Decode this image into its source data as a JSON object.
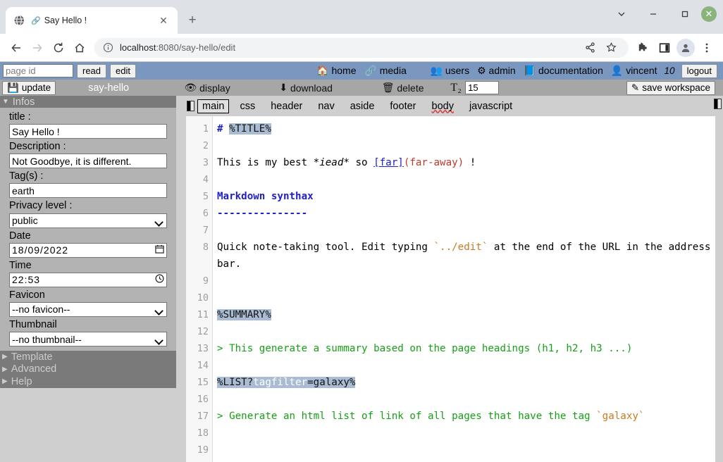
{
  "browser": {
    "tab": {
      "title": "Say Hello !",
      "favicon_icon": "globe-icon",
      "close_icon": "close-icon"
    },
    "newtab_icon": "plus-icon",
    "window": {
      "chevron_icon": "chevron-down-icon",
      "minimize_icon": "minimize-icon",
      "maximize_icon": "maximize-icon",
      "close_icon": "window-close-icon"
    },
    "nav": {
      "back_icon": "back-arrow-icon",
      "forward_icon": "forward-arrow-icon",
      "reload_icon": "reload-icon",
      "home_icon": "home-icon",
      "info_icon": "info-circle-icon",
      "url_host": "localhost",
      "url_path": ":8080/say-hello/edit",
      "share_icon": "share-icon",
      "bookmark_icon": "star-icon",
      "extensions_icon": "puzzle-icon",
      "sidepanel_icon": "side-panel-icon",
      "profile_icon": "profile-avatar-icon",
      "menu_icon": "three-dot-menu-icon"
    }
  },
  "app": {
    "topbar": {
      "page_id_placeholder": "page id",
      "page_id_value": "",
      "read_label": "read",
      "edit_label": "edit",
      "center_links": [
        {
          "icon": "home-icon",
          "label": "home"
        },
        {
          "icon": "link-icon",
          "label": "media"
        }
      ],
      "right_links": [
        {
          "icon": "users-icon",
          "label": "users"
        },
        {
          "icon": "gear-icon",
          "label": "admin"
        },
        {
          "icon": "book-icon",
          "label": "documentation"
        },
        {
          "icon": "user-icon",
          "label": "vincent"
        }
      ],
      "user_count": "10",
      "logout_label": "logout"
    },
    "toolbar": {
      "update_label": "update",
      "update_icon": "save-disk-icon",
      "page_name": "say-hello",
      "display_label": "display",
      "display_icon": "eye-icon",
      "download_label": "download",
      "download_icon": "download-icon",
      "delete_label": "delete",
      "delete_icon": "trash-icon",
      "fontsize_icon": "text-size-icon",
      "fontsize_value": "15",
      "save_workspace_label": "save workspace",
      "save_workspace_icon": "edit-square-icon"
    },
    "sidebar": {
      "infos_section": {
        "label": "Infos",
        "expanded": true,
        "caret_icon": "caret-down-icon"
      },
      "fields": [
        {
          "label": "title :",
          "name": "title-field",
          "type": "text",
          "value": "Say Hello !"
        },
        {
          "label": "Description :",
          "name": "description-field",
          "type": "text",
          "value": "Not Goodbye, it is different."
        },
        {
          "label": "Tag(s) :",
          "name": "tags-field",
          "type": "text",
          "value": "earth"
        },
        {
          "label": "Privacy level :",
          "name": "privacy-level-select",
          "type": "select",
          "value": "public"
        },
        {
          "label": "Date",
          "name": "date-field",
          "type": "date",
          "value": "18/09/2022",
          "icon": "calendar-icon"
        },
        {
          "label": "Time",
          "name": "time-field",
          "type": "time",
          "value": "22:53",
          "icon": "clock-icon"
        },
        {
          "label": "Favicon",
          "name": "favicon-select",
          "type": "select",
          "value": "--no favicon--"
        },
        {
          "label": "Thumbnail",
          "name": "thumbnail-select",
          "type": "select",
          "value": "--no thumbnail--"
        }
      ],
      "collapsed_sections": [
        {
          "label": "Template",
          "caret_icon": "caret-right-icon"
        },
        {
          "label": "Advanced",
          "caret_icon": "caret-right-icon"
        },
        {
          "label": "Help",
          "caret_icon": "caret-right-icon"
        }
      ]
    },
    "editor": {
      "left_collapse_icon": "panel-collapse-left-icon",
      "right_collapse_icon": "panel-collapse-right-icon",
      "tabs": [
        {
          "label": "main",
          "active": true
        },
        {
          "label": "css",
          "active": false
        },
        {
          "label": "header",
          "active": false
        },
        {
          "label": "nav",
          "active": false
        },
        {
          "label": "aside",
          "active": false
        },
        {
          "label": "footer",
          "active": false
        },
        {
          "label": "body",
          "active": false,
          "spellcheck_underline": true
        },
        {
          "label": "javascript",
          "active": false
        }
      ],
      "line_numbers": [
        "1",
        "2",
        "3",
        "4",
        "5",
        "6",
        "7",
        "8",
        "9",
        "10",
        "11",
        "12",
        "13",
        "14",
        "15",
        "16",
        "17",
        "18",
        "19"
      ],
      "lines": [
        {
          "n": 1,
          "text": "# %TITLE%"
        },
        {
          "n": 2,
          "text": ""
        },
        {
          "n": 3,
          "text": "This is my best *iead* so [far](far-away) !"
        },
        {
          "n": 4,
          "text": ""
        },
        {
          "n": 5,
          "text": "Markdown synthax"
        },
        {
          "n": 6,
          "text": "---------------"
        },
        {
          "n": 7,
          "text": ""
        },
        {
          "n": 8,
          "text": "Quick note-taking tool. Edit typing `../edit` at the end of the URL in the address bar."
        },
        {
          "n": 9,
          "text": ""
        },
        {
          "n": 10,
          "text": ""
        },
        {
          "n": 11,
          "text": "%SUMMARY%"
        },
        {
          "n": 12,
          "text": ""
        },
        {
          "n": 13,
          "text": "> This generate a summary based on the page headings (h1, h2, h3 ...)"
        },
        {
          "n": 14,
          "text": ""
        },
        {
          "n": 15,
          "text": "%LIST?tagfilter=galaxy%"
        },
        {
          "n": 16,
          "text": ""
        },
        {
          "n": 17,
          "text": "> Generate an html list of link of all pages that have the tag `galaxy`"
        },
        {
          "n": 18,
          "text": ""
        },
        {
          "n": 19,
          "text": ""
        }
      ]
    }
  }
}
